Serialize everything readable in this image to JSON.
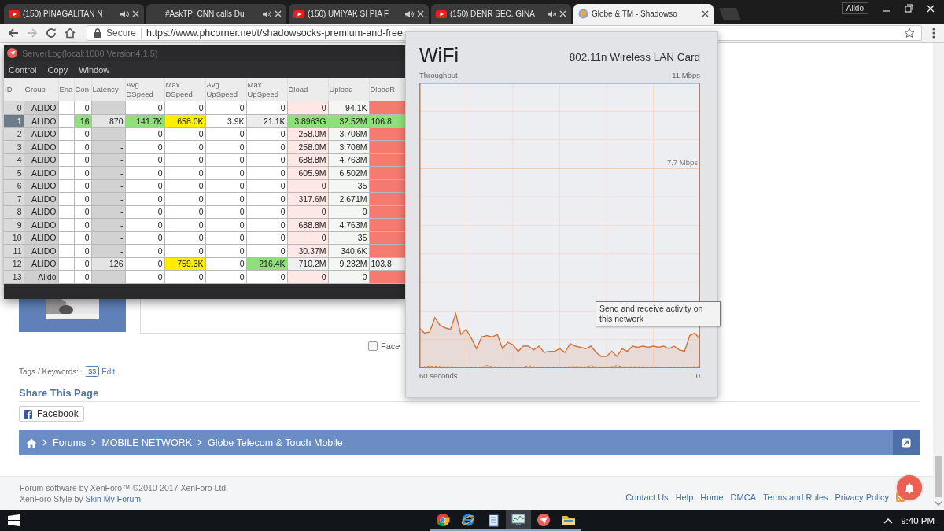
{
  "browser": {
    "tabs": [
      {
        "title": "(150) PINAGALITAN N",
        "kind": "youtube",
        "audio": true,
        "selected": false
      },
      {
        "title": "#AskTP: CNN calls Du",
        "kind": "plain",
        "audio": true,
        "selected": false
      },
      {
        "title": "(150) UMIYAK SI PIA F",
        "kind": "youtube",
        "audio": true,
        "selected": false
      },
      {
        "title": "(150) DENR SEC. GINA",
        "kind": "youtube",
        "audio": true,
        "selected": false
      },
      {
        "title": "Globe & TM - Shadowso",
        "kind": "site",
        "audio": false,
        "selected": true
      }
    ],
    "profile": "Alido",
    "address": {
      "secure_label": "Secure",
      "url": "https://www.phcorner.net/t/shadowsocks-premium-and-free."
    }
  },
  "page": {
    "facebook_checkbox": {
      "label": "Face",
      "checked": false
    },
    "tags": {
      "label": "Tags / Keywords:",
      "items": [
        "ss"
      ],
      "edit": "Edit"
    },
    "share": {
      "title": "Share This Page",
      "buttons": [
        "Facebook"
      ]
    },
    "breadcrumb": [
      "Forums",
      "MOBILE NETWORK",
      "Globe Telecom & Touch Mobile"
    ],
    "footer": {
      "credit": "Forum software by XenForo™ ©2010-2017 XenForo Ltd.",
      "style_prefix": "XenForo Style by",
      "style_link": "Skin My Forum",
      "links": [
        "Contact Us",
        "Help",
        "Home",
        "DMCA",
        "Terms and Rules",
        "Privacy Policy"
      ]
    }
  },
  "server_log": {
    "title": "ServerLog(local:1080 Version4.1.5)",
    "menu": [
      "Control",
      "Copy",
      "Window"
    ],
    "columns": [
      "ID",
      "Group",
      "Ena",
      "Con",
      "Latency",
      "Avg DSpeed",
      "Max DSpeed",
      "Avg UpSpeed",
      "Max UpSpeed",
      "Dload",
      "Upload",
      "DloadR"
    ],
    "rows": [
      {
        "selected": false,
        "cells": [
          "0",
          "ALIDO",
          "",
          "0",
          "-",
          "0",
          "0",
          "0",
          "0",
          "0",
          "94.1K",
          ""
        ]
      },
      {
        "selected": true,
        "cells": [
          "1",
          "ALIDO",
          "",
          {
            "text": "16",
            "color": "#8ee07a"
          },
          {
            "text": "870",
            "color": "#e4e4e4"
          },
          {
            "text": "141.7K",
            "color": "#8ee07a"
          },
          {
            "text": "658.0K",
            "color": "#ffee00"
          },
          "3.9K",
          {
            "text": "21.1K",
            "color": "#ececec"
          },
          {
            "text": "3.8963G",
            "color": "#8ee07a"
          },
          {
            "text": "32.52M",
            "color": "#8ee07a"
          },
          {
            "text": "106.8",
            "color": "#8ee07a"
          }
        ]
      },
      {
        "selected": false,
        "cells": [
          "2",
          "ALIDO",
          "",
          "0",
          "-",
          "0",
          "0",
          "0",
          "0",
          "258.0M",
          "3.706M",
          ""
        ]
      },
      {
        "selected": false,
        "cells": [
          "3",
          "ALIDO",
          "",
          "0",
          "-",
          "0",
          "0",
          "0",
          "0",
          "258.0M",
          "3.706M",
          ""
        ]
      },
      {
        "selected": false,
        "cells": [
          "4",
          "ALIDO",
          "",
          "0",
          "-",
          "0",
          "0",
          "0",
          "0",
          "688.8M",
          "4.763M",
          ""
        ]
      },
      {
        "selected": false,
        "cells": [
          "5",
          "ALIDO",
          "",
          "0",
          "-",
          "0",
          "0",
          "0",
          "0",
          "605.9M",
          "6.502M",
          ""
        ]
      },
      {
        "selected": false,
        "cells": [
          "6",
          "ALIDO",
          "",
          "0",
          "-",
          "0",
          "0",
          "0",
          "0",
          "0",
          "35",
          ""
        ]
      },
      {
        "selected": false,
        "cells": [
          "7",
          "ALIDO",
          "",
          "0",
          "-",
          "0",
          "0",
          "0",
          "0",
          "317.6M",
          "2.671M",
          ""
        ]
      },
      {
        "selected": false,
        "cells": [
          "8",
          "ALIDO",
          "",
          "0",
          "-",
          "0",
          "0",
          "0",
          "0",
          "0",
          "0",
          ""
        ]
      },
      {
        "selected": false,
        "cells": [
          "9",
          "ALIDO",
          "",
          "0",
          "-",
          "0",
          "0",
          "0",
          "0",
          "688.8M",
          "4.763M",
          ""
        ]
      },
      {
        "selected": false,
        "cells": [
          "10",
          "ALIDO",
          "",
          "0",
          "-",
          "0",
          "0",
          "0",
          "0",
          "0",
          "35",
          ""
        ]
      },
      {
        "selected": false,
        "cells": [
          "11",
          "ALIDO",
          "",
          "0",
          "-",
          "0",
          "0",
          "0",
          "0",
          "30.37M",
          "340.6K",
          ""
        ]
      },
      {
        "selected": false,
        "cells": [
          "12",
          "ALIDO",
          "",
          "0",
          {
            "text": "126",
            "color": "#e4e4e4"
          },
          "0",
          {
            "text": "759.3K",
            "color": "#ffee00"
          },
          "0",
          {
            "text": "216.4K",
            "color": "#8ee07a"
          },
          {
            "text": "710.2M",
            "color": "#f0f0f0"
          },
          "9.232M",
          {
            "text": "103.8",
            "color": "#f0f0f0"
          }
        ]
      },
      {
        "selected": false,
        "cells": [
          "13",
          "Alido",
          "",
          "0",
          "-",
          "0",
          "0",
          "0",
          "0",
          "0",
          "0",
          ""
        ]
      }
    ]
  },
  "wifi": {
    "title": "WiFi",
    "adapter": "802.11n Wireless LAN Card",
    "graph_label": "Throughput",
    "scale_max": "11 Mbps",
    "scale_mark": "7.7 Mbps",
    "span_label": "60 seconds",
    "end_label": "0"
  },
  "tooltip": "Send and receive activity on this network",
  "taskbar": {
    "apps": [
      {
        "kind": "chrome",
        "active": false
      },
      {
        "kind": "ie",
        "active": false
      },
      {
        "kind": "notepad",
        "active": false
      },
      {
        "kind": "taskmgr",
        "active": true
      },
      {
        "kind": "shadowsocks",
        "active": false
      },
      {
        "kind": "explorer",
        "active": false
      }
    ],
    "time": "9:40 PM"
  }
}
